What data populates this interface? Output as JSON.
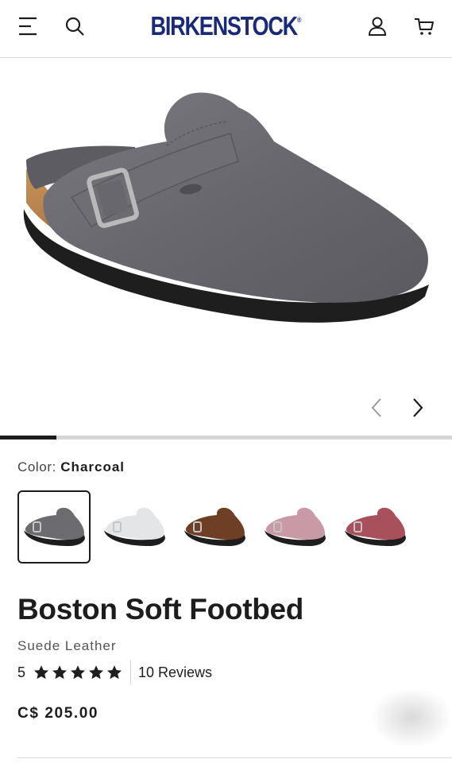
{
  "header": {
    "brand": "BIRKENSTOCK",
    "brand_mark": "®",
    "icons": [
      "menu-icon",
      "search-icon",
      "account-icon",
      "cart-icon"
    ]
  },
  "gallery": {
    "current_image": 1,
    "progress_fraction": 0.125
  },
  "color": {
    "label": "Color:",
    "selected": "Charcoal",
    "swatches": [
      {
        "name": "Charcoal",
        "hex": "#6b6b70",
        "selected": true
      },
      {
        "name": "Light Gray",
        "hex": "#e3e5e6",
        "selected": false
      },
      {
        "name": "Brown",
        "hex": "#6e3f25",
        "selected": false
      },
      {
        "name": "Pink",
        "hex": "#c99aa5",
        "selected": false
      },
      {
        "name": "Berry",
        "hex": "#a8515c",
        "selected": false
      }
    ]
  },
  "product": {
    "title": "Boston Soft Footbed",
    "material": "Suede Leather",
    "rating": "5",
    "stars": 5,
    "reviews": "10 Reviews",
    "price": "C$ 205.00"
  },
  "colors": {
    "brand": "#1a2a78",
    "text": "#1d1d1d"
  }
}
